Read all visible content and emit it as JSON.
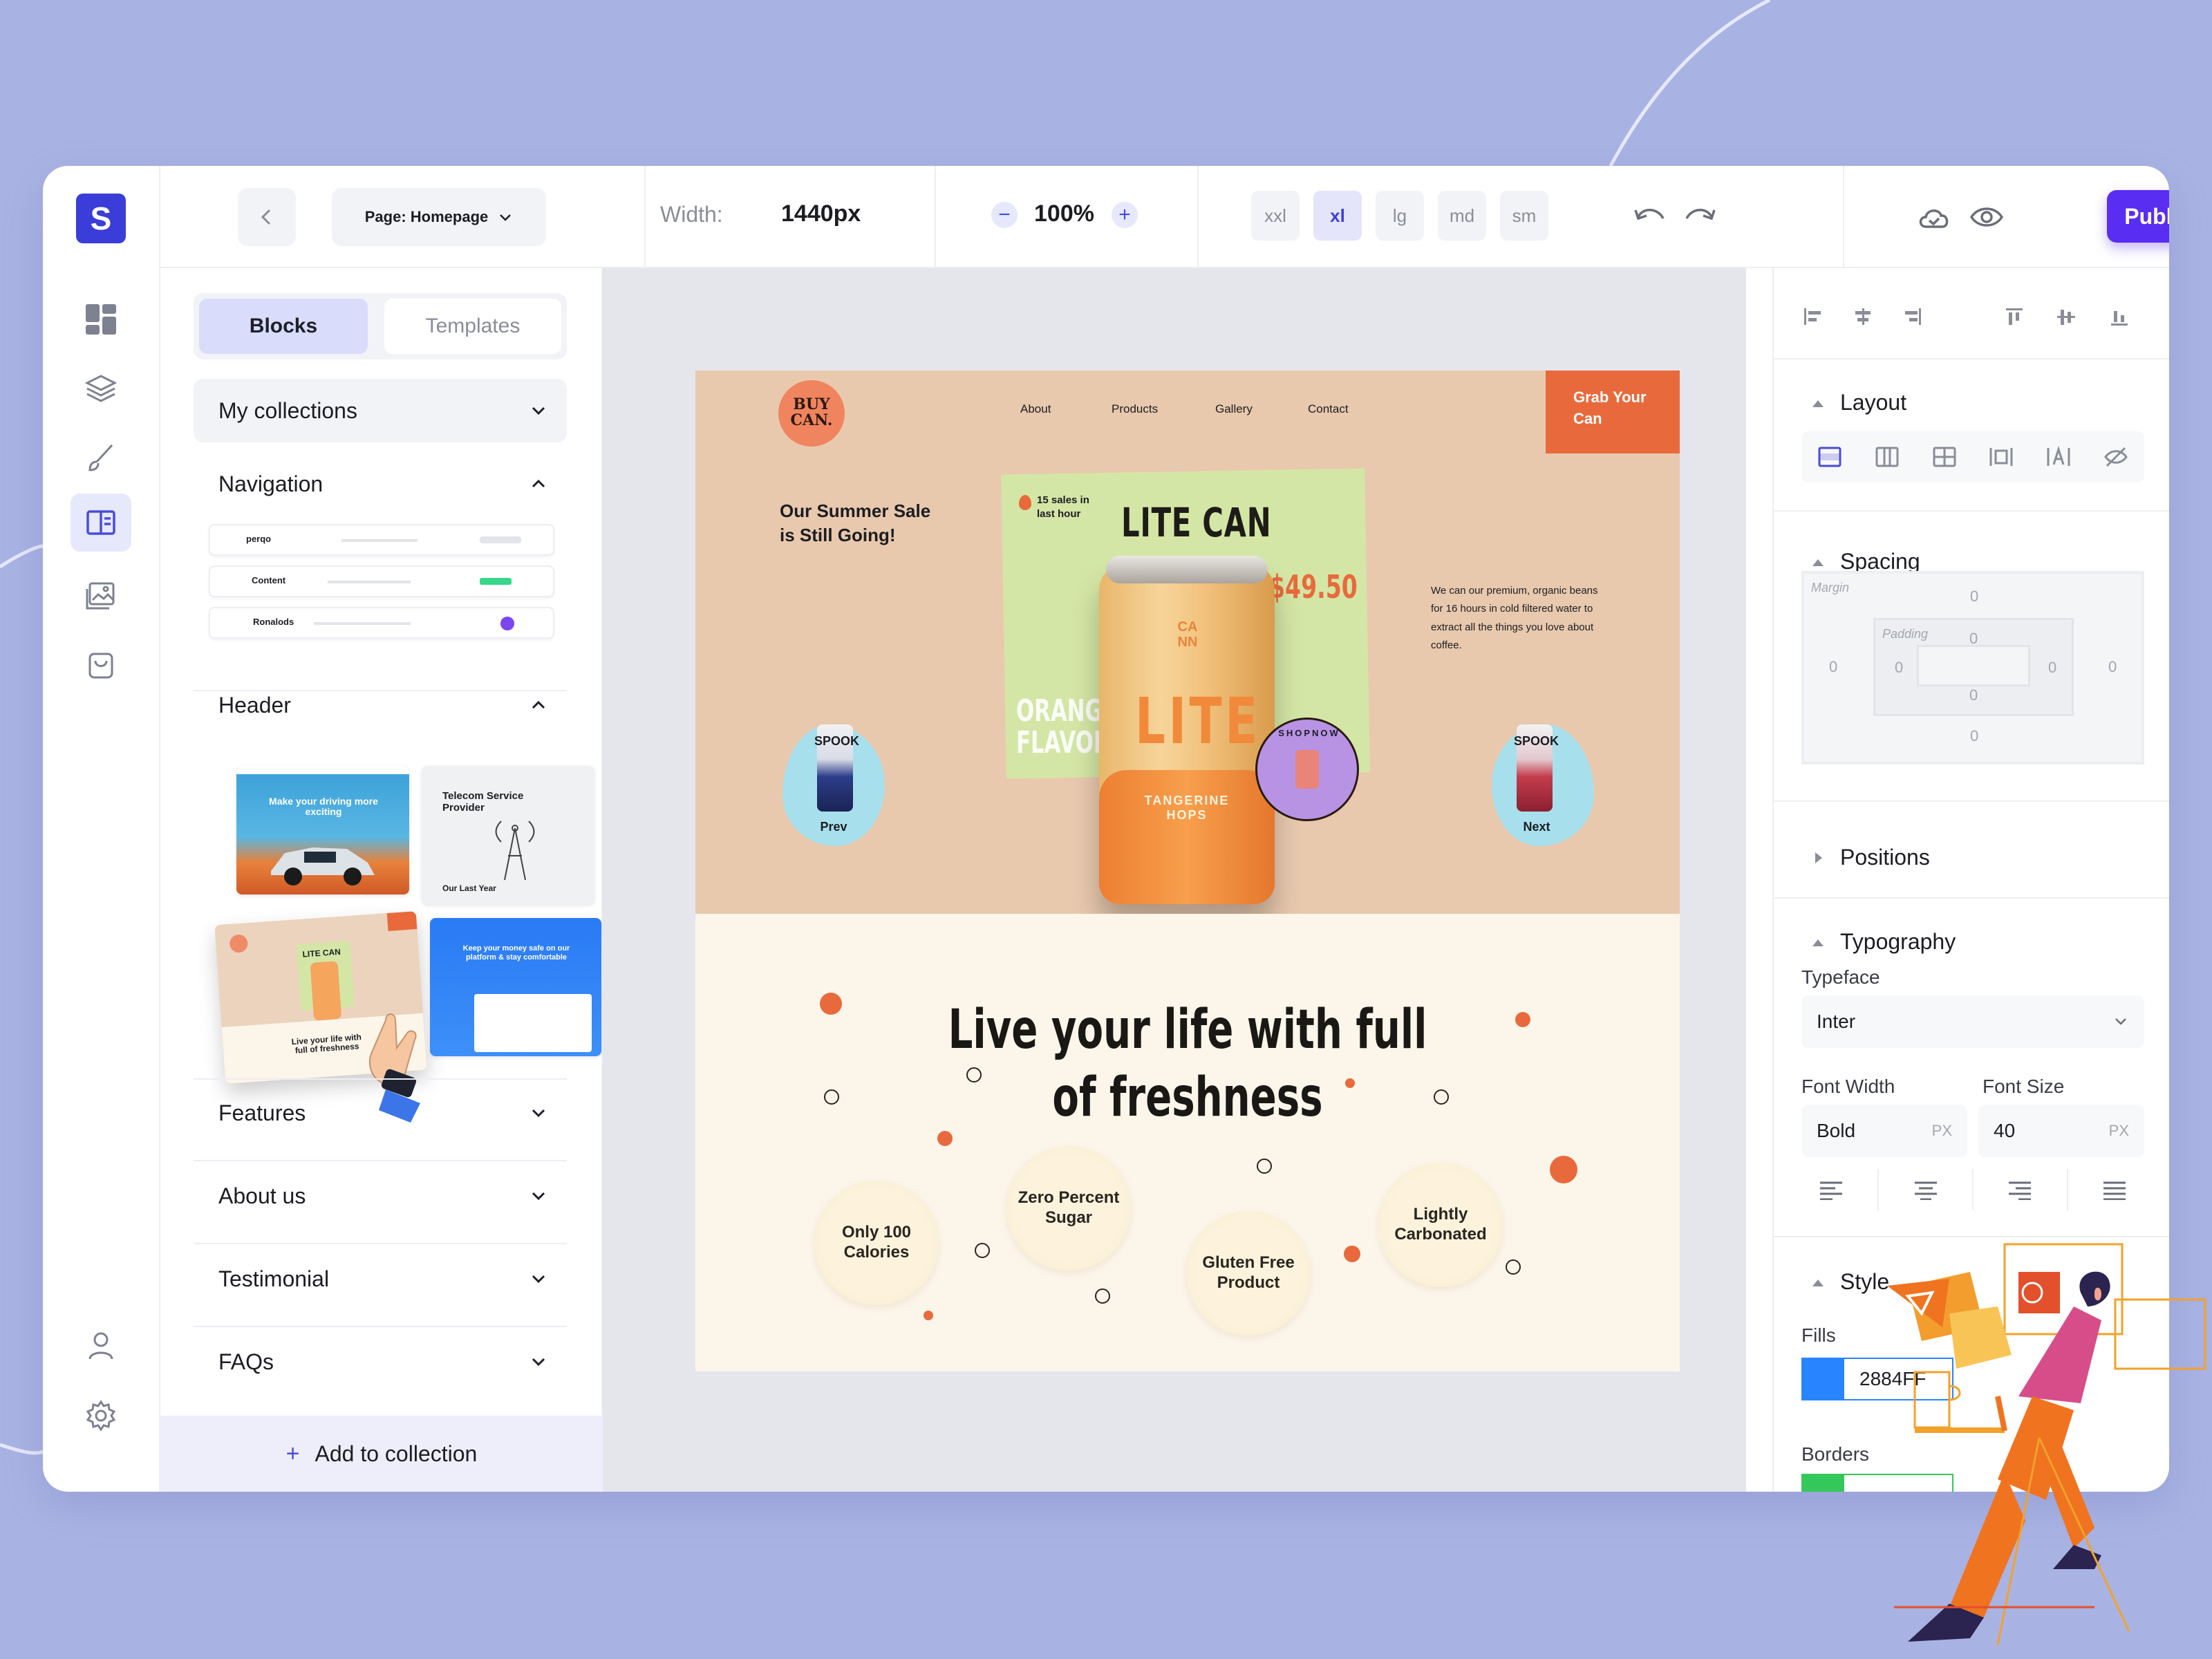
{
  "app": {
    "logo_letter": "S",
    "accent": "#5A2DF2",
    "brand": "#3B3DD8"
  },
  "toolbar": {
    "page_label": "Page:",
    "page_name": "Homepage",
    "width_label": "Width:",
    "width_value": "1440px",
    "zoom_value": "100%",
    "zoom_minus": "−",
    "zoom_plus": "+",
    "breakpoints": [
      "xxl",
      "xl",
      "lg",
      "md",
      "sm"
    ],
    "active_breakpoint": "xl",
    "publish_label": "Publish"
  },
  "rail": {
    "items": [
      "dashboard-icon",
      "layers-icon",
      "brush-icon",
      "blocks-icon",
      "image-icon",
      "bag-icon",
      "user-icon",
      "settings-icon"
    ],
    "active": "blocks-icon"
  },
  "left_panel": {
    "tabs": [
      "Blocks",
      "Templates"
    ],
    "active_tab": "Blocks",
    "collections_label": "My collections",
    "sections": {
      "navigation": "Navigation",
      "header": "Header",
      "features": "Features",
      "about": "About us",
      "testimonial": "Testimonial",
      "faqs": "FAQs"
    },
    "nav_thumbs": [
      "perqo",
      "Content",
      "Ronalods"
    ],
    "header_thumbs": {
      "t1": "Make your driving more exciting",
      "t2_title": "Telecom Service Provider",
      "t2_sub": "Our Last Year",
      "t3": "Live your life with full of freshness",
      "t3_title": "LITE CAN",
      "t4": "Keep your money safe on our platform & stay comfortable"
    },
    "add_collection": "Add to collection"
  },
  "site": {
    "logo": "BUY CAN.",
    "nav": [
      "About",
      "Products",
      "Gallery",
      "Contact"
    ],
    "cta": "Grab Your Can",
    "sale_text": "Our Summer Sale is Still Going!",
    "badge": "15 sales in last hour",
    "product_title": "LITE CAN",
    "price": "$49.50",
    "flavor": "ORANGE FLAVOR",
    "can_text": "LITE",
    "can_brand": "CA NN",
    "can_sub": "TANGERINE HOPS",
    "stamp": "SHOPNOW",
    "description": "We can our premium, organic beans for 16 hours in cold filtered water to extract all the things you love about coffee.",
    "prev": "Prev",
    "next": "Next",
    "side_can": "SPOOK",
    "headline_1": "Live your life with full",
    "headline_2": "of freshness",
    "features": [
      "Only 100 Calories",
      "Zero Percent Sugar",
      "Gluten Free Product",
      "Lightly Carbonated"
    ],
    "colors": {
      "peach": "#E8C9AE",
      "orange": "#E86A3C",
      "cream": "#FCF5EA",
      "green": "#D4E6A5"
    }
  },
  "right_panel": {
    "layout": "Layout",
    "spacing": "Spacing",
    "margin_label": "Margin",
    "padding_label": "Padding",
    "margin_values": [
      "0",
      "0",
      "0",
      "0"
    ],
    "padding_values": [
      "0",
      "0",
      "0",
      "0"
    ],
    "positions": "Positions",
    "typography": "Typography",
    "typeface_label": "Typeface",
    "typeface": "Inter",
    "font_width_label": "Font Width",
    "font_width": "Bold",
    "font_size_label": "Font Size",
    "font_size": "40",
    "unit": "PX",
    "style": "Style",
    "fills_label": "Fills",
    "fill_hex": "2884FF",
    "fill_color": "#2884FF",
    "borders_label": "Borders",
    "border_color": "#34C759"
  }
}
